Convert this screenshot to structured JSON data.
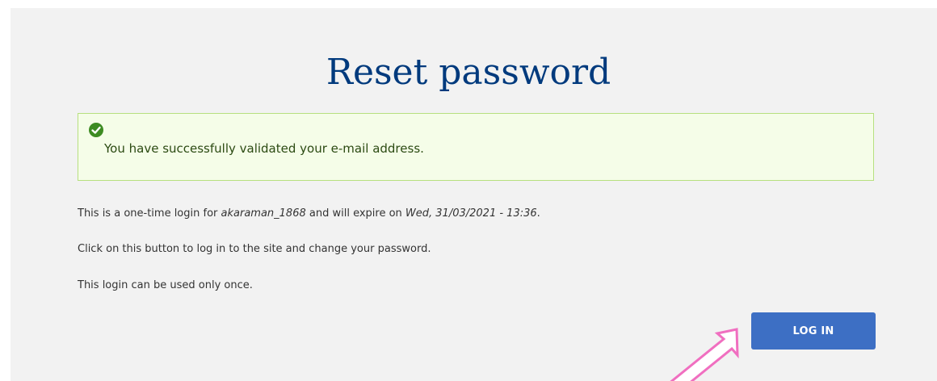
{
  "page": {
    "title": "Reset password"
  },
  "alert": {
    "icon": "check-circle-icon",
    "message": "You have successfully validated your e-mail address.",
    "accent_color": "#3d8b22",
    "background_color": "#f5fde8"
  },
  "info": {
    "line1_prefix": "This is a one-time login for ",
    "username": "akaraman_1868",
    "line1_middle": " and will expire on ",
    "expiry": "Wed, 31/03/2021 - 13:36",
    "line1_suffix": ".",
    "line2": "Click on this button to log in to the site and change your password.",
    "line3": "This login can be used only once."
  },
  "actions": {
    "login_label": "LOG IN",
    "login_color": "#3d6fc4"
  },
  "annotation": {
    "arrow_icon": "arrow-pointer-icon",
    "arrow_color": "#f06fc0"
  }
}
